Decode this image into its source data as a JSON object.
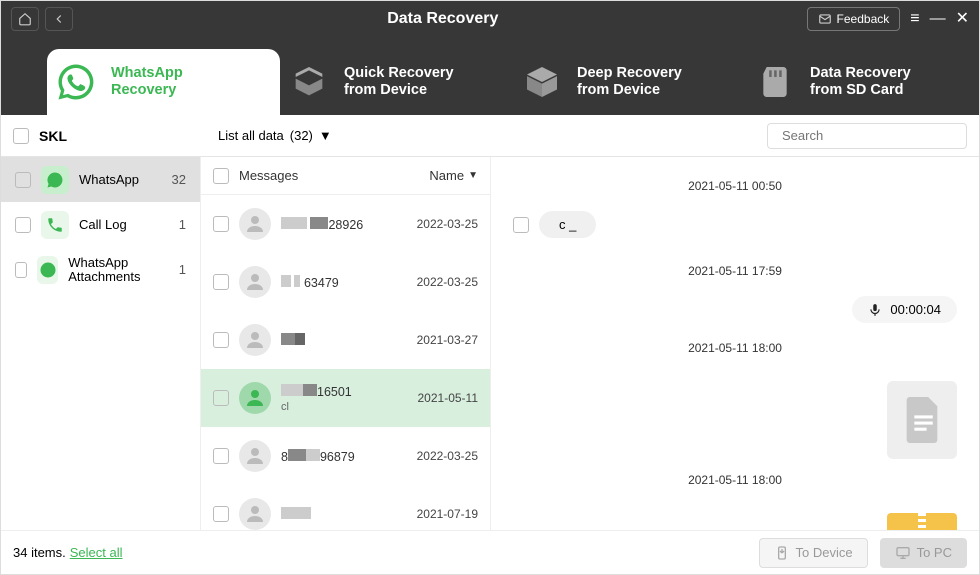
{
  "title": "Data Recovery",
  "feedback_label": "Feedback",
  "tabs": {
    "whatsapp": "WhatsApp\nRecovery",
    "quick": "Quick Recovery\nfrom Device",
    "deep": "Deep Recovery\nfrom Device",
    "sd": "Data Recovery\nfrom SD Card"
  },
  "account": "SKL",
  "filter_label": "List all data",
  "filter_count": "(32)",
  "search_placeholder": "Search",
  "sidebar": [
    {
      "label": "WhatsApp",
      "count": "32"
    },
    {
      "label": "Call Log",
      "count": "1"
    },
    {
      "label": "WhatsApp Attachments",
      "count": "1"
    }
  ],
  "midhead": {
    "col1": "Messages",
    "col2": "Name"
  },
  "conversations": [
    {
      "name_suffix": "28926",
      "date": "2022-03-25"
    },
    {
      "name_suffix": "63479",
      "date": "2022-03-25"
    },
    {
      "name_suffix": "",
      "date": "2021-03-27"
    },
    {
      "name_suffix": "16501",
      "date": "2021-05-11"
    },
    {
      "name_suffix": "96879",
      "date": "2022-03-25"
    },
    {
      "name_suffix": "",
      "date": "2021-07-19"
    }
  ],
  "detail": {
    "ts1": "2021-05-11 00:50",
    "bubble1": "c _",
    "ts2": "2021-05-11 17:59",
    "voice_time": "00:00:04",
    "ts3": "2021-05-11 18:00",
    "ts4": "2021-05-11 18:00"
  },
  "footer": {
    "count": "34 items.",
    "select_all": "Select all",
    "to_device": "To Device",
    "to_pc": "To PC"
  }
}
